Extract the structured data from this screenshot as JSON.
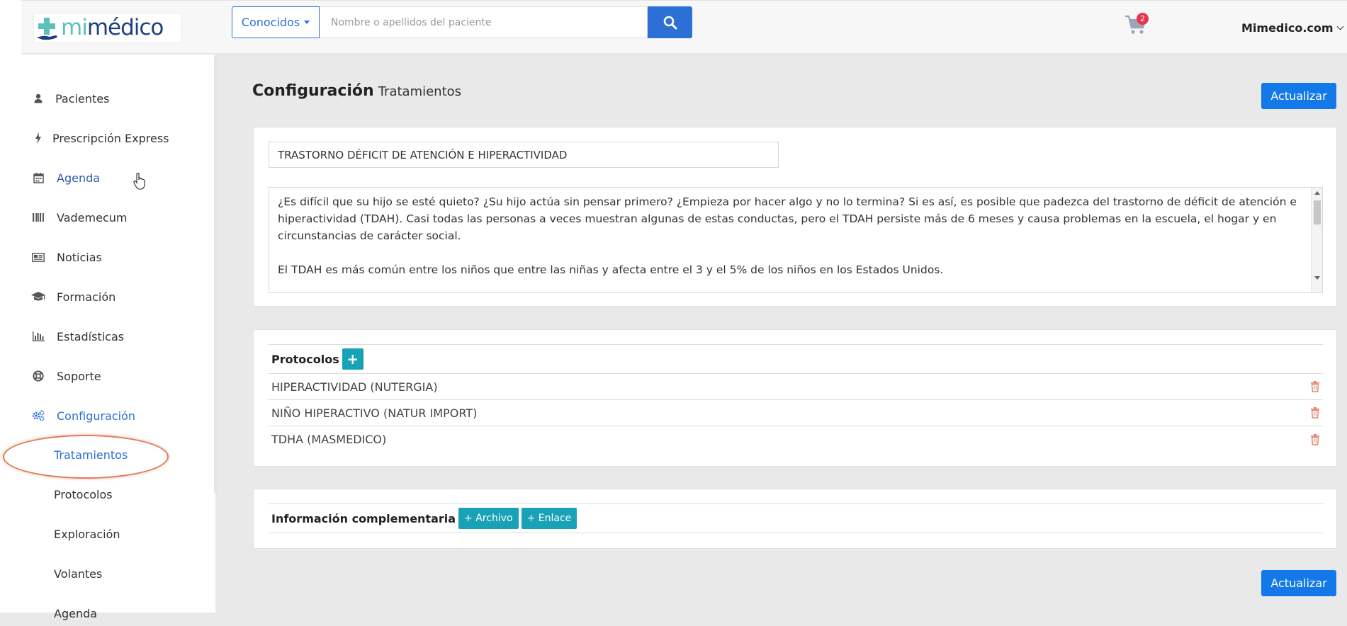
{
  "header": {
    "logo": {
      "part1": "mi",
      "part2": "médico"
    },
    "search": {
      "filter_label": "Conocidos",
      "placeholder": "Nombre o apellidos del paciente"
    },
    "cart_count": "2",
    "user_menu_label": "Mimedico.com"
  },
  "sidebar": {
    "items": [
      {
        "label": "Pacientes",
        "icon": "user-icon"
      },
      {
        "label": "Prescripción Express",
        "icon": "bolt-icon"
      },
      {
        "label": "Agenda",
        "icon": "calendar-icon"
      },
      {
        "label": "Vademecum",
        "icon": "barcode-icon"
      },
      {
        "label": "Noticias",
        "icon": "newspaper-icon"
      },
      {
        "label": "Formación",
        "icon": "graduation-cap-icon"
      },
      {
        "label": "Estadísticas",
        "icon": "bar-chart-icon"
      },
      {
        "label": "Soporte",
        "icon": "life-ring-icon"
      },
      {
        "label": "Configuración",
        "icon": "cogs-icon"
      }
    ],
    "subitems": [
      {
        "label": "Tratamientos"
      },
      {
        "label": "Protocolos"
      },
      {
        "label": "Exploración"
      },
      {
        "label": "Volantes"
      },
      {
        "label": "Agenda"
      }
    ]
  },
  "main": {
    "title": "Configuración",
    "subtitle": "Tratamientos",
    "update_label": "Actualizar",
    "treatment_name": "TRASTORNO DÉFICIT DE ATENCIÓN E HIPERACTIVIDAD",
    "description_p1": "¿Es difícil que su hijo se esté quieto? ¿Su hijo actúa sin pensar primero? ¿Empieza por hacer algo y no lo termina? Si es así, es posible que padezca del trastorno de déficit de atención e hiperactividad (TDAH). Casi todas las personas a veces muestran algunas de estas conductas, pero el TDAH persiste más de 6 meses y causa problemas en la escuela, el hogar y en circunstancias de carácter social.",
    "description_p2": "El TDAH es más común entre los niños que entre las niñas y afecta entre el 3 y el 5% de los niños en los Estados Unidos.",
    "protocols": {
      "title": "Protocolos",
      "add_label": "+",
      "items": [
        {
          "name": "HIPERACTIVIDAD (NUTERGIA)"
        },
        {
          "name": "NIÑO HIPERACTIVO (NATUR IMPORT)"
        },
        {
          "name": "TDHA (MASMEDICO)"
        }
      ]
    },
    "complementary": {
      "title": "Información complementaria",
      "file_label": "+ Archivo",
      "link_label": "+ Enlace"
    }
  },
  "colors": {
    "primary": "#1479e8",
    "accent_blue": "#2c6fd6",
    "teal": "#17a2b8",
    "badge_red": "#e8344e",
    "trash_red": "#e8806e",
    "highlight_orange": "#e07b57"
  }
}
